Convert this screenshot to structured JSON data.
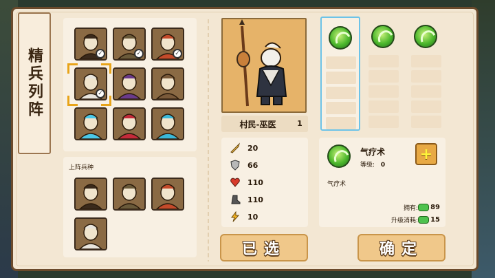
{
  "title": "精兵列阵",
  "roster": {
    "units": [
      {
        "name": "warrior-bare",
        "color": "#3a2a1c",
        "selected": true
      },
      {
        "name": "armored-soldier",
        "color": "#6a5a3a",
        "selected": true
      },
      {
        "name": "red-hair-warrior",
        "color": "#c44a2a",
        "selected": true
      },
      {
        "name": "white-hair-shaman",
        "color": "#e8e4dc",
        "selected": true
      },
      {
        "name": "purple-wizard",
        "color": "#6a3a8a",
        "selected": false
      },
      {
        "name": "cannon",
        "color": "#7a5a3a",
        "selected": false
      },
      {
        "name": "ice-dragon",
        "color": "#4ac8e8",
        "selected": false
      },
      {
        "name": "red-knight",
        "color": "#c42a3a",
        "selected": false
      },
      {
        "name": "blue-knight",
        "color": "#3ab8d8",
        "selected": false
      }
    ]
  },
  "deployed": {
    "label": "上阵兵种",
    "units": [
      "warrior-bare",
      "armored-soldier",
      "red-hair-warrior",
      "white-hair-shaman"
    ]
  },
  "hero": {
    "name": "村民-巫医",
    "level": "1"
  },
  "stats": [
    {
      "icon": "sword-icon",
      "value": "20"
    },
    {
      "icon": "shield-icon",
      "value": "66"
    },
    {
      "icon": "heart-icon",
      "value": "110"
    },
    {
      "icon": "boot-icon",
      "value": "110"
    },
    {
      "icon": "lightning-icon",
      "value": "10"
    }
  ],
  "skill": {
    "name": "气疗术",
    "level_label": "等级:",
    "level_value": "0",
    "description": "气疗术",
    "own_label": "拥有:",
    "own_value": "89",
    "cost_label": "升级消耗:",
    "cost_value": "15"
  },
  "buttons": {
    "selected": "已选",
    "confirm": "确定"
  },
  "colors": {
    "panel": "#f3e7d3",
    "border": "#6b4a2b",
    "accent": "#e8a419",
    "skill_active": "#6cc3e8"
  }
}
